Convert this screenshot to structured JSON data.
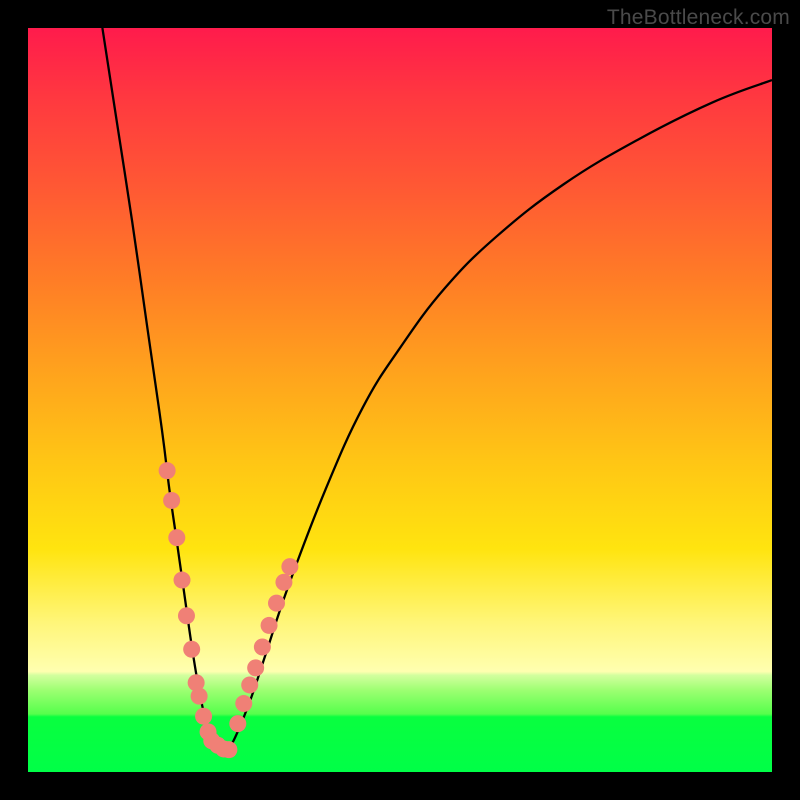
{
  "watermark": "TheBottleneck.com",
  "chart_data": {
    "type": "line",
    "title": "",
    "xlabel": "",
    "ylabel": "",
    "xlim": [
      0,
      100
    ],
    "ylim": [
      0,
      100
    ],
    "curve": {
      "name": "bottleneck-v-curve",
      "x": [
        10,
        12,
        14,
        16,
        18,
        19,
        20,
        21,
        22,
        23,
        24,
        25,
        26,
        27,
        28,
        30,
        32,
        35,
        40,
        45,
        50,
        56,
        63,
        72,
        82,
        92,
        100
      ],
      "y": [
        100,
        87,
        74,
        60,
        46,
        38,
        31,
        24,
        17,
        11,
        6.5,
        4,
        3,
        3.4,
        5,
        10,
        16,
        25,
        38,
        49,
        57,
        65,
        72,
        79,
        85,
        90,
        93
      ]
    },
    "series": [
      {
        "name": "left-branch-dots",
        "x": [
          18.7,
          19.3,
          20.0,
          20.7,
          21.3,
          22.0,
          22.6,
          23.0,
          23.6,
          24.2,
          24.7,
          25.5,
          26.3,
          27.0
        ],
        "y": [
          40.5,
          36.5,
          31.5,
          25.8,
          21.0,
          16.5,
          12.0,
          10.2,
          7.5,
          5.4,
          4.2,
          3.6,
          3.1,
          3.0
        ]
      },
      {
        "name": "right-branch-dots",
        "x": [
          28.2,
          29.0,
          29.8,
          30.6,
          31.5,
          32.4,
          33.4,
          34.4,
          35.2
        ],
        "y": [
          6.5,
          9.2,
          11.7,
          14.0,
          16.8,
          19.7,
          22.7,
          25.5,
          27.6
        ]
      }
    ],
    "colors": {
      "curve": "#000000",
      "dots": "#f08076",
      "gradient_top": "#ff1b4c",
      "gradient_mid": "#ffe40f",
      "gradient_bottom": "#00ff47"
    }
  }
}
